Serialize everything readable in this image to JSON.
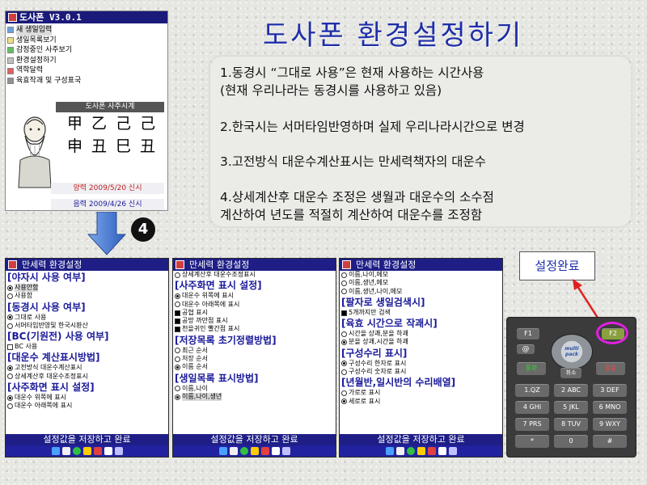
{
  "title": "도사폰 환경설정하기",
  "main_phone": {
    "app_name": "도사폰 V3.0.1",
    "menu": [
      "새 생일입력",
      "생일목록보기",
      "감정중인 사주보기",
      "환경설정하기",
      "역학달력",
      "육효작괘 및 구성표국"
    ],
    "saju_title": "도사폰 사주시계",
    "pillars_top": "甲乙己己",
    "pillars_bottom": "申丑巳丑",
    "solar": "양력 2009/5/20 신시",
    "lunar": "음력 2009/4/26 신시"
  },
  "instructions": [
    "1.동경시 “그대로 사용”은 현재 사용하는 시간사용",
    "(현재 우리나라는 동경시를 사용하고 있음)",
    "2.한국시는 서머타임반영하며 실제 우리나라시간으로 변경",
    "3.고전방식 대운수계산표시는 만세력책자의 대운수",
    "4.상세계산후 대운수 조정은 생월과 대운수의 소수점",
    "계산하여 년도를 적절히 계산하여 대운수를 조정함"
  ],
  "step_badge": "4",
  "settings_screens": [
    {
      "title": "만세력 환경설정",
      "sections": [
        {
          "heading": "[야자시 사용 여부]",
          "options": [
            {
              "type": "radio",
              "label": "사용안함",
              "on": true,
              "hl": true
            },
            {
              "type": "radio",
              "label": "사용함",
              "on": false
            }
          ]
        },
        {
          "heading": "[동경시 사용 여부]",
          "options": [
            {
              "type": "radio",
              "label": "그대로 사용",
              "on": true
            },
            {
              "type": "radio",
              "label": "서머타임반영및 한국시환산",
              "on": false
            }
          ]
        },
        {
          "heading": "[BC(기원전) 사용 여부]",
          "options": [
            {
              "type": "check",
              "label": "BC 사용",
              "on": false
            }
          ]
        },
        {
          "heading": "[대운수 계산표시방법]",
          "options": [
            {
              "type": "radio",
              "label": "고전방식 대운수계산표시",
              "on": true
            },
            {
              "type": "radio",
              "label": "상세계산후 대운수조정표시",
              "on": false
            }
          ]
        },
        {
          "heading": "[사주화면 표시 설정]",
          "options": [
            {
              "type": "radio",
              "label": "대운수 위쪽에 표시",
              "on": true
            },
            {
              "type": "radio",
              "label": "대운수 아래쪽에 표시",
              "on": false
            }
          ]
        }
      ],
      "save_label": "설정값을 저장하고 완료"
    },
    {
      "title": "만세력 환경설정",
      "sections": [
        {
          "heading": "",
          "options": [
            {
              "type": "radio",
              "label": "상세계산후 대운수조정표시",
              "on": false
            }
          ]
        },
        {
          "heading": "[사주화면 표시 설정]",
          "options": [
            {
              "type": "radio",
              "label": "대운수 위쪽에 표시",
              "on": true
            },
            {
              "type": "radio",
              "label": "대운수 아래쪽에 표시",
              "on": false
            },
            {
              "type": "check",
              "label": "공협 표시",
              "on": true
            },
            {
              "type": "check",
              "label": "공망 까만점 표시",
              "on": true
            },
            {
              "type": "check",
              "label": "천을귀인 빨간점 표시",
              "on": true
            }
          ]
        },
        {
          "heading": "[저장목록 초기정렬방법]",
          "options": [
            {
              "type": "radio",
              "label": "최근 순서",
              "on": false
            },
            {
              "type": "radio",
              "label": "저장 순서",
              "on": false
            },
            {
              "type": "radio",
              "label": "이름 순서",
              "on": true
            }
          ]
        },
        {
          "heading": "[생일목록 표시방법]",
          "options": [
            {
              "type": "radio",
              "label": "이름,나이",
              "on": false
            },
            {
              "type": "radio",
              "label": "이름,나이,생년",
              "on": true,
              "hl": true
            }
          ]
        }
      ],
      "save_label": "설정값을 저장하고 완료"
    },
    {
      "title": "만세력 환경설정",
      "sections": [
        {
          "heading": "",
          "options": [
            {
              "type": "radio",
              "label": "이름,나이,메모",
              "on": false
            },
            {
              "type": "radio",
              "label": "이름,생년,메모",
              "on": false
            },
            {
              "type": "radio",
              "label": "이름,생년,나이,메모",
              "on": false
            }
          ]
        },
        {
          "heading": "[팔자로 생일검색시]",
          "options": [
            {
              "type": "check",
              "label": "5개까지만 검색",
              "on": true
            }
          ]
        },
        {
          "heading": "[육효 시간으로 작괘시]",
          "options": [
            {
              "type": "radio",
              "label": "시간을 상괘,분을 하괘",
              "on": false
            },
            {
              "type": "radio",
              "label": "분을 상괘,시간을 하괘",
              "on": true
            }
          ]
        },
        {
          "heading": "[구성수리 표시]",
          "options": [
            {
              "type": "radio",
              "label": "구성수리 한자로 표시",
              "on": true
            },
            {
              "type": "radio",
              "label": "구성수리 숫자로 표시",
              "on": false
            }
          ]
        },
        {
          "heading": "[년월반,일시반의 수리배열]",
          "options": [
            {
              "type": "radio",
              "label": "가로로 표시",
              "on": false
            },
            {
              "type": "radio",
              "label": "세로로 표시",
              "on": true
            }
          ]
        }
      ],
      "save_label": "설정값을 저장하고 완료"
    }
  ],
  "done_label": "설정완료",
  "keypad": {
    "f1": "F1",
    "f2": "F2",
    "call": "통화",
    "cancel": "취소",
    "end": "종료",
    "nav_center": "multi pack",
    "keys": [
      "1.QZ",
      "2 ABC",
      "3 DEF",
      "4 GHI",
      "5 JKL",
      "6 MNO",
      "7 PRS",
      "8 TUV",
      "9 WXY",
      "*",
      "0",
      "#"
    ]
  },
  "colors": {
    "title_blue": "#1f2fa8",
    "screen_bar": "#1e1e86",
    "highlight_ring": "#e020e0",
    "arrow_red": "#e02020"
  }
}
